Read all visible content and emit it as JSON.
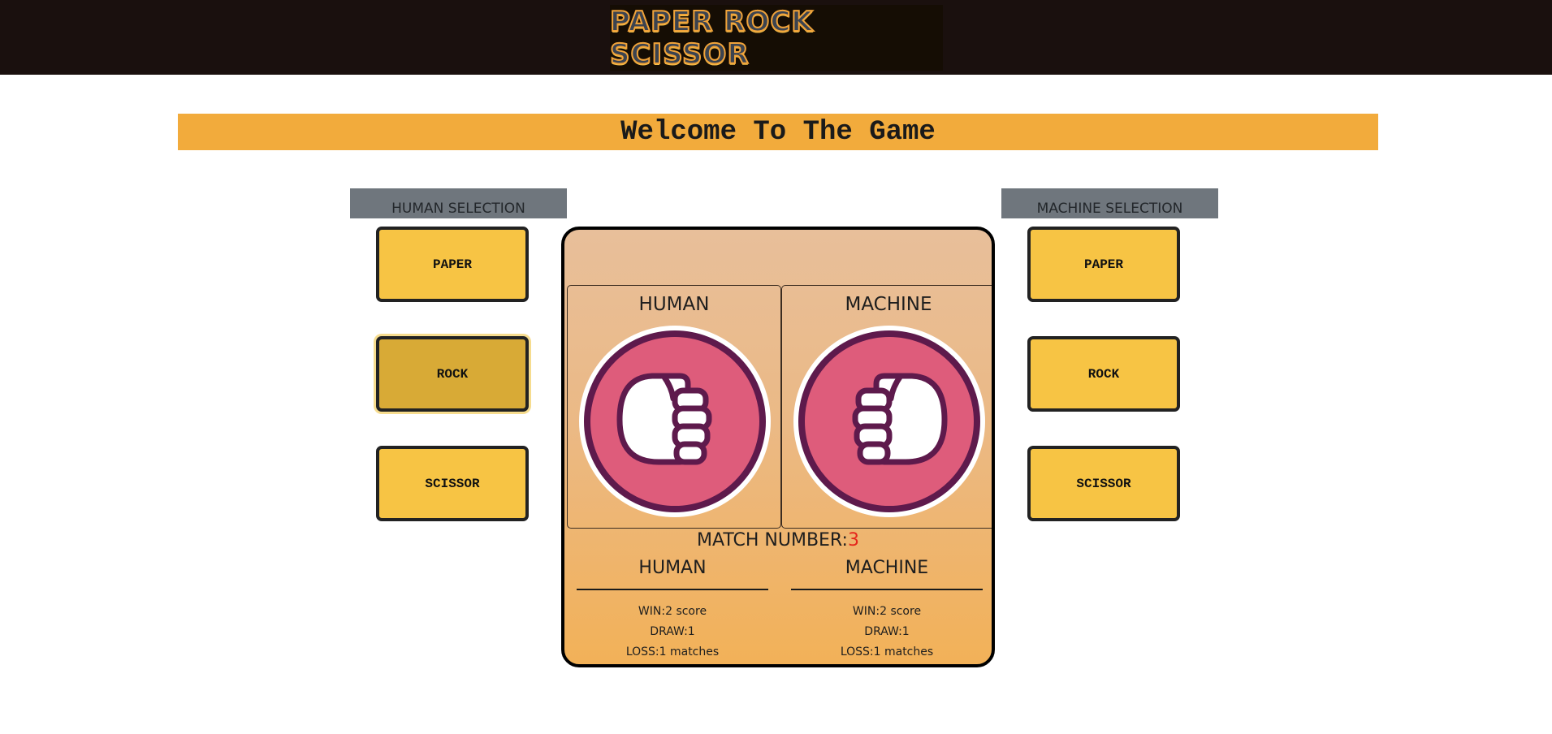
{
  "header": {
    "logo_text": "PAPER ROCK SCISSOR"
  },
  "welcome": {
    "title": "Welcome To The Game"
  },
  "human_selection": {
    "title": "HUMAN SELECTION",
    "options": [
      "PAPER",
      "ROCK",
      "SCISSOR"
    ],
    "selected": "ROCK"
  },
  "machine_selection": {
    "title": "MACHINE SELECTION",
    "options": [
      "PAPER",
      "ROCK",
      "SCISSOR"
    ]
  },
  "arena": {
    "human_label": "HUMAN",
    "machine_label": "MACHINE",
    "human_hand_icon": "rock-fist-icon",
    "machine_hand_icon": "rock-fist-icon",
    "match_label": "MATCH NUMBER:",
    "match_number": "3"
  },
  "scoreboard": {
    "human": {
      "name": "HUMAN",
      "win": "WIN:2 score",
      "draw": "DRAW:1",
      "loss": "LOSS:1 matches"
    },
    "machine": {
      "name": "MACHINE",
      "win": "WIN:2 score",
      "draw": "DRAW:1",
      "loss": "LOSS:1 matches"
    }
  },
  "colors": {
    "topbar": "#1a100e",
    "welcome_bar": "#f2ab3c",
    "button": "#f7c444",
    "button_selected": "#d8aa36",
    "hand_circle": "#de5c7b",
    "hand_outline": "#5e1a4c",
    "match_number": "#e4251c"
  }
}
